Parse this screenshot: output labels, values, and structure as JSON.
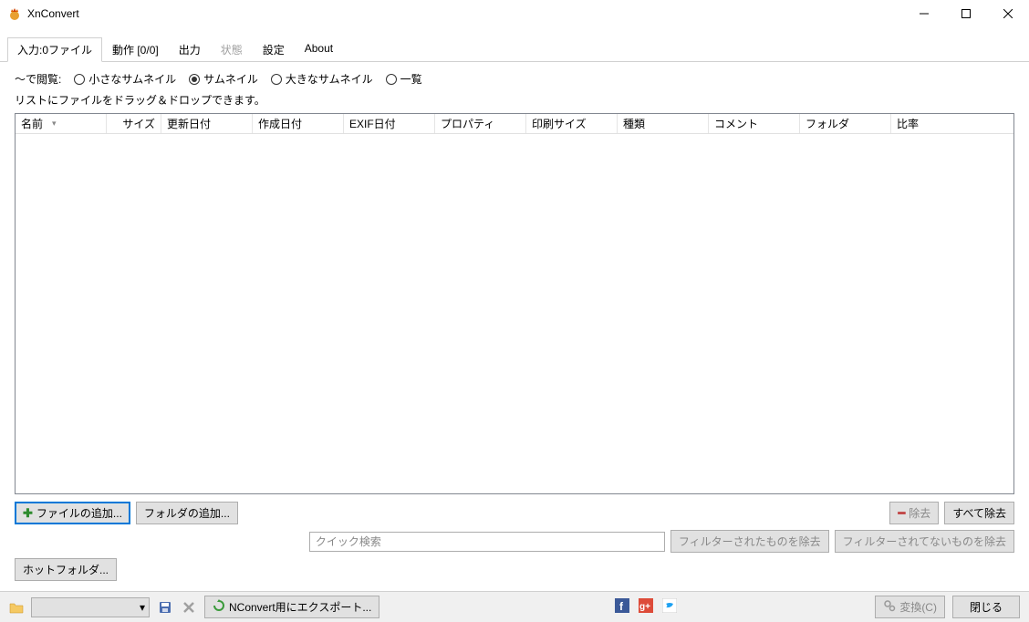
{
  "window": {
    "title": "XnConvert"
  },
  "tabs": [
    {
      "label": "入力:0ファイル",
      "active": true,
      "disabled": false
    },
    {
      "label": "動作 [0/0]",
      "active": false,
      "disabled": false
    },
    {
      "label": "出力",
      "active": false,
      "disabled": false
    },
    {
      "label": "状態",
      "active": false,
      "disabled": true
    },
    {
      "label": "設定",
      "active": false,
      "disabled": false
    },
    {
      "label": "About",
      "active": false,
      "disabled": false
    }
  ],
  "view": {
    "prefix": "～で閲覧:",
    "options": [
      {
        "label": "小さなサムネイル",
        "checked": false
      },
      {
        "label": "サムネイル",
        "checked": true
      },
      {
        "label": "大きなサムネイル",
        "checked": false
      },
      {
        "label": "一覧",
        "checked": false
      }
    ]
  },
  "hint": "リストにファイルをドラッグ＆ドロップできます。",
  "columns": [
    {
      "label": "名前",
      "width": 100,
      "sorted": true
    },
    {
      "label": "サイズ",
      "width": 60
    },
    {
      "label": "更新日付",
      "width": 100
    },
    {
      "label": "作成日付",
      "width": 100
    },
    {
      "label": "EXIF日付",
      "width": 100
    },
    {
      "label": "プロパティ",
      "width": 100
    },
    {
      "label": "印刷サイズ",
      "width": 100
    },
    {
      "label": "種類",
      "width": 100
    },
    {
      "label": "コメント",
      "width": 100
    },
    {
      "label": "フォルダ",
      "width": 100
    },
    {
      "label": "比率",
      "width": 90
    }
  ],
  "buttons": {
    "add_file": "ファイルの追加...",
    "add_folder": "フォルダの追加...",
    "remove": "除去",
    "remove_all": "すべて除去",
    "hot_folder": "ホットフォルダ...",
    "export_nconvert": "NConvert用にエクスポート...",
    "convert": "変換(C)",
    "close": "閉じる"
  },
  "filter": {
    "placeholder": "クイック検索",
    "remove_filtered": "フィルターされたものを除去",
    "remove_not_filtered": "フィルターされてないものを除去"
  },
  "icons": {
    "save": "save-icon",
    "delete": "delete-icon",
    "folder": "folder-icon",
    "refresh": "refresh-icon"
  }
}
